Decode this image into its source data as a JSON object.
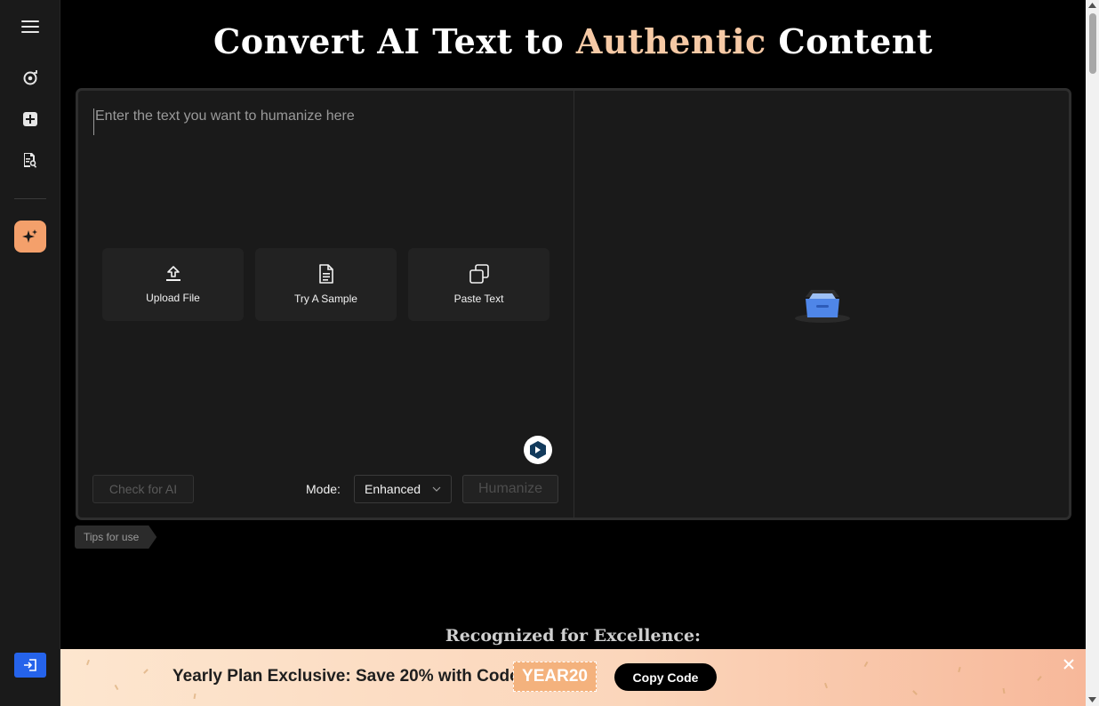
{
  "title": {
    "prefix": "Convert AI Text to ",
    "accent": "Authentic",
    "suffix": " Content"
  },
  "editor": {
    "placeholder": "Enter the text you want to humanize here",
    "actions": [
      {
        "label": "Upload File",
        "icon": "upload-icon"
      },
      {
        "label": "Try A Sample",
        "icon": "document-icon"
      },
      {
        "label": "Paste Text",
        "icon": "copy-icon"
      }
    ],
    "check_label": "Check for AI",
    "mode_label": "Mode:",
    "mode_value": "Enhanced",
    "humanize_label": "Humanize"
  },
  "sidebar": {
    "items": [
      {
        "icon": "menu-icon"
      },
      {
        "icon": "refresh-icon"
      },
      {
        "icon": "add-icon"
      },
      {
        "icon": "doc-search-icon"
      },
      {
        "icon": "sparkle-icon",
        "active": true
      },
      {
        "icon": "login-icon"
      }
    ]
  },
  "tips_label": "Tips for use",
  "recognized": "Recognized for Excellence:",
  "promo": {
    "text": "Yearly Plan Exclusive: Save 20% with Code",
    "code": "YEAR20",
    "copy_label": "Copy Code"
  },
  "colors": {
    "accent": "#f6c9a5",
    "sidebar_active": "#f4a06b",
    "login_btn": "#2563eb"
  }
}
